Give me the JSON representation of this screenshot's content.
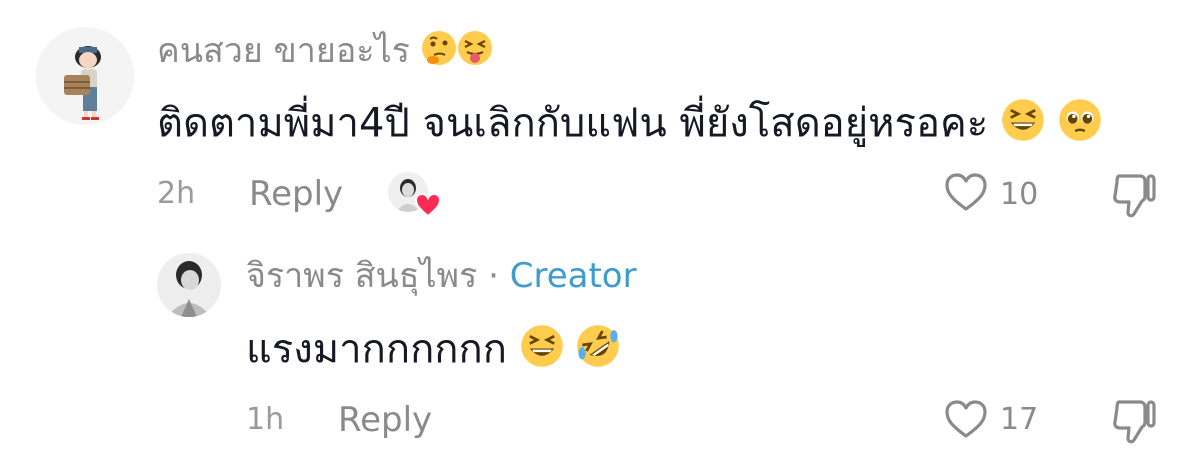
{
  "comments": [
    {
      "username": "คนสวย ขายอะไร",
      "username_emojis": [
        "thinking-face-emoji",
        "squinting-tongue-emoji"
      ],
      "text": "ติดตามพี่มา4ปี จนเลิกกับแฟน พี่ยังโสดอยู่หรอคะ",
      "text_emojis": [
        "grinning-squinting-emoji",
        "pleading-face-emoji"
      ],
      "time": "2h",
      "reply_label": "Reply",
      "likes": "10"
    }
  ],
  "reply": {
    "username": "จิราพร สินธุไพร",
    "separator": "·",
    "badge": "Creator",
    "text": "แรงมากกกกกก",
    "text_emojis": [
      "grinning-squinting-emoji",
      "rolling-on-floor-laughing-emoji"
    ],
    "time": "1h",
    "reply_label": "Reply",
    "likes": "17"
  },
  "colors": {
    "creator": "#3c9ccf",
    "heart_badge": "#fe2c55",
    "muted": "#8a8a8a",
    "text": "#161823"
  }
}
